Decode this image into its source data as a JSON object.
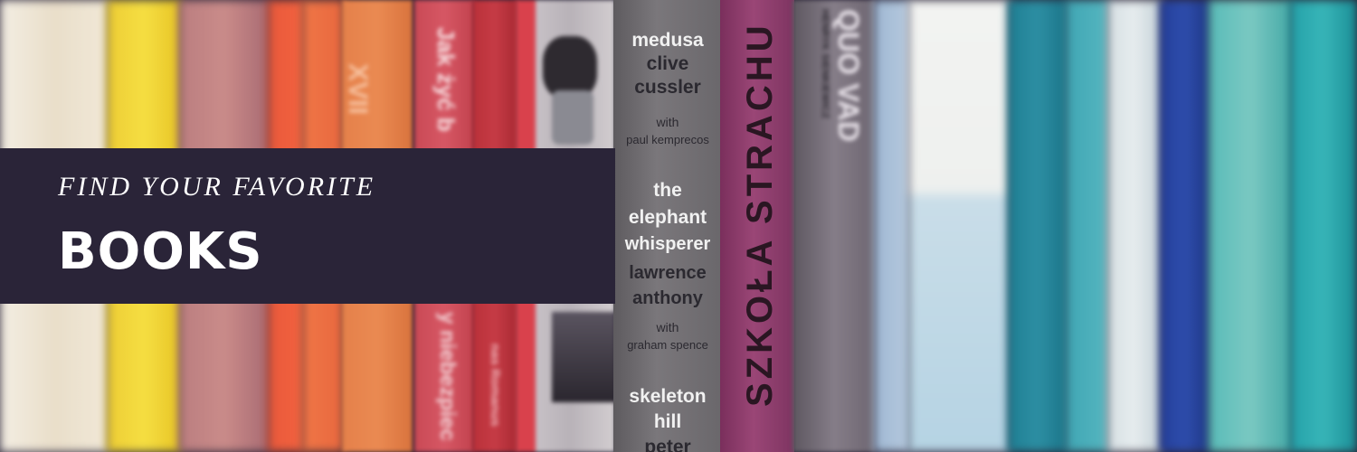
{
  "banner": {
    "tagline": "FIND YOUR FAVORITE",
    "title": "BOOKS",
    "overlay_color": "#2a2438",
    "text_color": "#ffffff"
  },
  "books": {
    "book1": {
      "text": "XVII",
      "color": "#e07a3c"
    },
    "book2": {
      "text": "Jak żyć b",
      "color": "#c7464f"
    },
    "book3": {
      "text": "y niebezpiec",
      "color": "#c7464f"
    },
    "book4": {
      "text": "nas Romanus",
      "color": "#b2323a"
    },
    "cussler": {
      "lines": [
        "medusa",
        "clive",
        "cussler",
        "with",
        "paul kemprecos",
        "the",
        "elephant",
        "whisperer",
        "lawrence",
        "anthony",
        "with",
        "graham spence",
        "skeleton",
        "hill",
        "peter"
      ],
      "color": "#6d6a6c"
    },
    "szkola": {
      "text": "SZKOŁA STRACHU",
      "color": "#8a3a68"
    },
    "quo": {
      "text": "QUO VAD",
      "author": "HENRYK SIENKIEWICZ",
      "color": "#7c7480"
    }
  }
}
